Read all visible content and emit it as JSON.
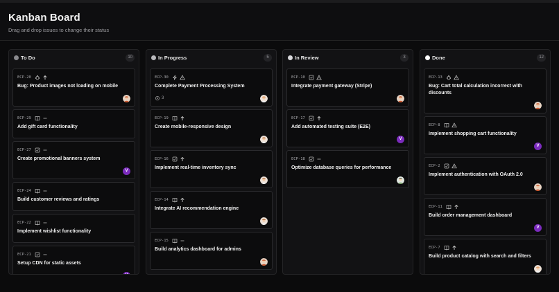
{
  "header": {
    "title": "Kanban Board",
    "subtitle": "Drag and drop issues to change their status"
  },
  "colors": {
    "background": "#0b0b0c",
    "column": "#121214",
    "card": "#0c0c0d",
    "avatar_purple": "#7b2bbd",
    "dot_todo": "#8a8a8e",
    "dot_inprogress": "#b9b9bd",
    "dot_inreview": "#d9d9dc",
    "dot_done": "#ffffff"
  },
  "columns": [
    {
      "title": "To Do",
      "count": "10",
      "cards": [
        {
          "id": "ECP-20",
          "type_icon": "bug-icon",
          "priority_icon": "arrow-up-icon",
          "title": "Bug: Product images not loading on mobile",
          "avatar": "person-avatar-icon"
        },
        {
          "id": "ECP-29",
          "type_icon": "book-icon",
          "priority_icon": "minus-icon",
          "title": "Add gift card functionality",
          "avatar": ""
        },
        {
          "id": "ECP-27",
          "type_icon": "checkbox-icon",
          "priority_icon": "minus-icon",
          "title": "Create promotional banners system",
          "avatar": "V"
        },
        {
          "id": "ECP-24",
          "type_icon": "book-icon",
          "priority_icon": "minus-icon",
          "title": "Build customer reviews and ratings",
          "avatar": ""
        },
        {
          "id": "ECP-22",
          "type_icon": "book-icon",
          "priority_icon": "minus-icon",
          "title": "Implement wishlist functionality",
          "avatar": ""
        },
        {
          "id": "ECP-21",
          "type_icon": "checkbox-icon",
          "priority_icon": "minus-icon",
          "title": "Setup CDN for static assets",
          "avatar": "V"
        }
      ]
    },
    {
      "title": "In Progress",
      "count": "5",
      "cards": [
        {
          "id": "ECP-30",
          "type_icon": "lightning-icon",
          "priority_icon": "warning-icon",
          "title": "Complete Payment Processing System",
          "extra": "3",
          "avatar": "person-avatar-icon"
        },
        {
          "id": "ECP-19",
          "type_icon": "book-icon",
          "priority_icon": "arrow-up-icon",
          "title": "Create mobile-responsive design",
          "avatar": "person-avatar-icon"
        },
        {
          "id": "ECP-16",
          "type_icon": "checkbox-icon",
          "priority_icon": "arrow-up-icon",
          "title": "Implement real-time inventory sync",
          "avatar": "person-avatar-icon"
        },
        {
          "id": "ECP-14",
          "type_icon": "book-icon",
          "priority_icon": "arrow-up-icon",
          "title": "Integrate AI recommendation engine",
          "avatar": "person-avatar-icon"
        },
        {
          "id": "ECP-15",
          "type_icon": "book-icon",
          "priority_icon": "minus-icon",
          "title": "Build analytics dashboard for admins",
          "avatar": "person-avatar-icon"
        }
      ]
    },
    {
      "title": "In Review",
      "count": "3",
      "cards": [
        {
          "id": "ECP-10",
          "type_icon": "checkbox-icon",
          "priority_icon": "warning-icon",
          "title": "Integrate payment gateway (Stripe)",
          "avatar": "person-avatar-icon"
        },
        {
          "id": "ECP-17",
          "type_icon": "checkbox-icon",
          "priority_icon": "arrow-up-icon",
          "title": "Add automated testing suite (E2E)",
          "avatar": "V"
        },
        {
          "id": "ECP-18",
          "type_icon": "checkbox-icon",
          "priority_icon": "minus-icon",
          "title": "Optimize database queries for performance",
          "avatar": "person-avatar-icon"
        }
      ]
    },
    {
      "title": "Done",
      "count": "12",
      "cards": [
        {
          "id": "ECP-13",
          "type_icon": "bug-icon",
          "priority_icon": "warning-icon",
          "title": "Bug: Cart total calculation incorrect with discounts",
          "avatar": "person-avatar-icon"
        },
        {
          "id": "ECP-8",
          "type_icon": "book-icon",
          "priority_icon": "warning-icon",
          "title": "Implement shopping cart functionality",
          "avatar": "V"
        },
        {
          "id": "ECP-2",
          "type_icon": "checkbox-icon",
          "priority_icon": "warning-icon",
          "title": "Implement authentication with OAuth 2.0",
          "avatar": "person-avatar-icon"
        },
        {
          "id": "ECP-11",
          "type_icon": "book-icon",
          "priority_icon": "arrow-up-icon",
          "title": "Build order management dashboard",
          "avatar": "V"
        },
        {
          "id": "ECP-7",
          "type_icon": "book-icon",
          "priority_icon": "arrow-up-icon",
          "title": "Build product catalog with search and filters",
          "avatar": "person-avatar-icon"
        }
      ]
    }
  ]
}
